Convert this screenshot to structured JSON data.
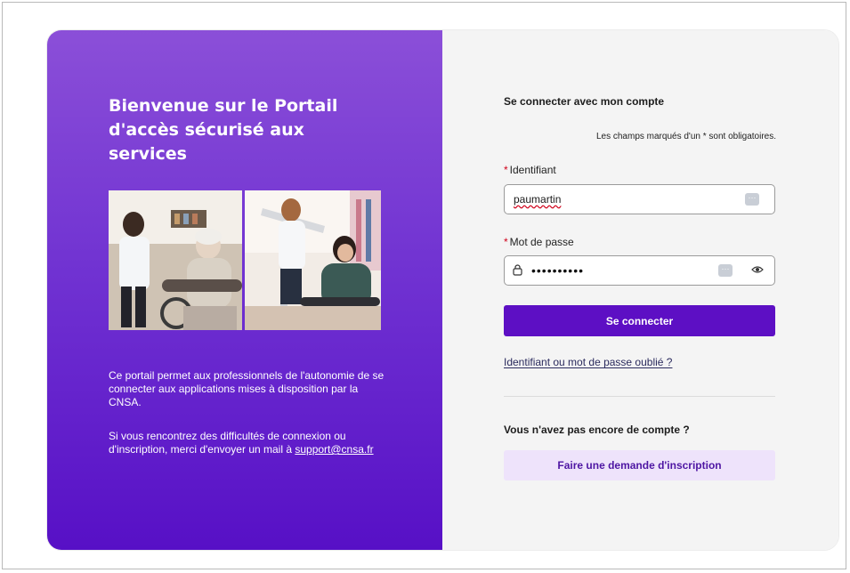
{
  "left": {
    "title": "Bienvenue sur le Portail d'accès sécurisé aux services",
    "intro": "Ce portail permet aux professionnels de l'autonomie de se connecter aux applications mises à disposition par la CNSA.",
    "help_prefix": "Si vous rencontrez des difficultés de connexion ou d'inscription, merci d'envoyer un mail à ",
    "support_email": "support@cnsa.fr",
    "colors": {
      "gradient_top": "#8b4fd8",
      "gradient_bottom": "#5710c6"
    }
  },
  "form": {
    "section_title": "Se connecter avec mon compte",
    "required_note": "Les champs marqués d'un * sont obligatoires.",
    "username_label": "Identifiant",
    "username_value": "paumartin",
    "password_label": "Mot de passe",
    "password_mask": "••••••••••",
    "submit_label": "Se connecter",
    "forgot_link": "Identifiant ou mot de passe oublié ?",
    "no_account_title": "Vous n'avez pas encore de compte ?",
    "register_label": "Faire une demande d'inscription",
    "colors": {
      "primary": "#5d0fc4",
      "required_star": "#d0021b",
      "register_bg": "#eee3fb"
    }
  },
  "icons": {
    "lock": "lock-icon",
    "eye": "eye-icon",
    "password_manager": "password-manager-icon"
  }
}
